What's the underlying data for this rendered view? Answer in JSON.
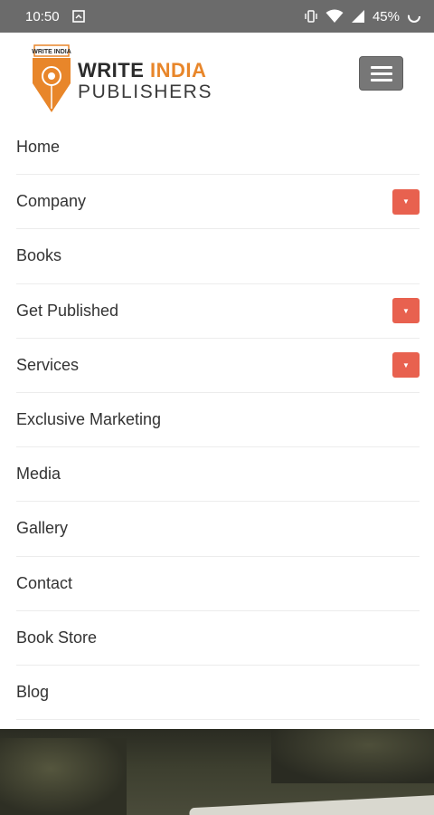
{
  "status_bar": {
    "time": "10:50",
    "battery": "45%"
  },
  "header": {
    "logo_small": "WRITE INDIA",
    "logo_word1": "WRITE",
    "logo_word2": "INDIA",
    "logo_line2": "PUBLISHERS"
  },
  "nav": {
    "items": [
      {
        "label": "Home",
        "has_dropdown": false
      },
      {
        "label": "Company",
        "has_dropdown": true
      },
      {
        "label": "Books",
        "has_dropdown": false
      },
      {
        "label": "Get Published",
        "has_dropdown": true
      },
      {
        "label": "Services",
        "has_dropdown": true
      },
      {
        "label": "Exclusive Marketing",
        "has_dropdown": false
      },
      {
        "label": "Media",
        "has_dropdown": false
      },
      {
        "label": "Gallery",
        "has_dropdown": false
      },
      {
        "label": "Contact",
        "has_dropdown": false
      },
      {
        "label": "Book Store",
        "has_dropdown": false
      },
      {
        "label": "Blog",
        "has_dropdown": false
      }
    ]
  },
  "colors": {
    "status_bar": "#6b6b6b",
    "accent_orange": "#e8862a",
    "dropdown_red": "#e8614f",
    "menu_button": "#777777"
  }
}
